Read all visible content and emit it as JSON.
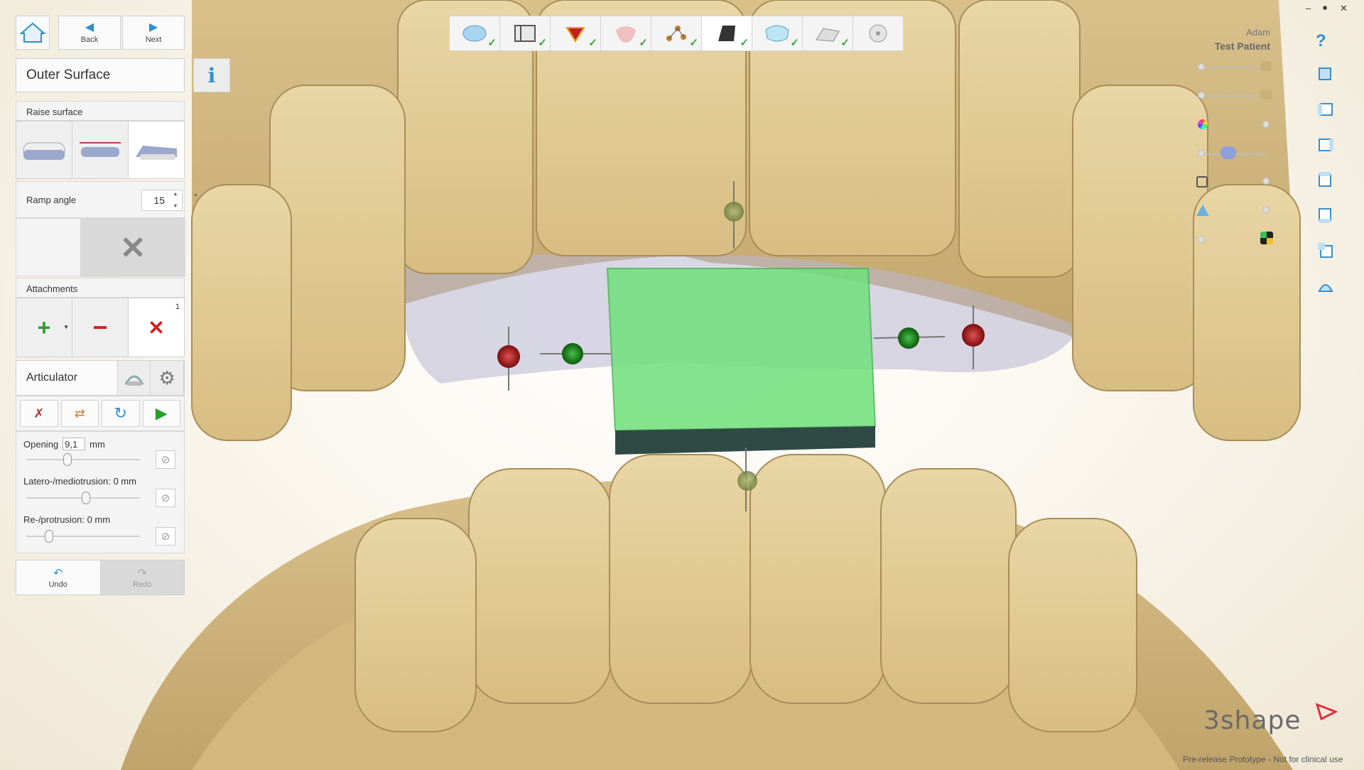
{
  "nav": {
    "back": "Back",
    "next": "Next"
  },
  "panel": {
    "title": "Outer Surface",
    "info_icon": "i",
    "raise_surface_label": "Raise surface",
    "raise_options": [
      "raise-full-icon",
      "raise-plane-icon",
      "raise-ramp-icon"
    ],
    "ramp_angle_label": "Ramp angle",
    "ramp_angle_value": "15",
    "ramp_angle_unit": "°",
    "attachments_label": "Attachments",
    "attachments_count": "1",
    "articulator_label": "Articulator",
    "opening_label": "Opening",
    "opening_value": "9,1",
    "opening_unit": "mm",
    "latero_label": "Latero-/mediotrusion: 0 mm",
    "protrusion_label": "Re-/protrusion: 0 mm",
    "undo": "Undo",
    "redo": "Redo"
  },
  "workflow": {
    "steps": [
      {
        "icon": "model-icon",
        "done": true
      },
      {
        "icon": "bite-icon",
        "done": true
      },
      {
        "icon": "color-map-icon",
        "done": true
      },
      {
        "icon": "gingiva-icon",
        "done": true
      },
      {
        "icon": "points-icon",
        "done": true
      },
      {
        "icon": "block-icon",
        "done": true,
        "active": true
      },
      {
        "icon": "outer-surface-icon",
        "done": true
      },
      {
        "icon": "plane-icon",
        "done": true
      },
      {
        "icon": "disc-icon",
        "done": false
      }
    ],
    "check_glyph": "✓"
  },
  "window": {
    "minimize": "–",
    "maximize": "■",
    "close": "✕"
  },
  "patient": {
    "first_name": "Adam",
    "last_name": "Test Patient"
  },
  "help": "?",
  "branding": {
    "logo": "3shape",
    "note": "Pre-release Prototype - Not for clinical use"
  },
  "colors": {
    "accent": "#2e8fcf",
    "check": "#3aa43a",
    "block": "#6fe07a",
    "tooth": "#e8d4a2"
  }
}
